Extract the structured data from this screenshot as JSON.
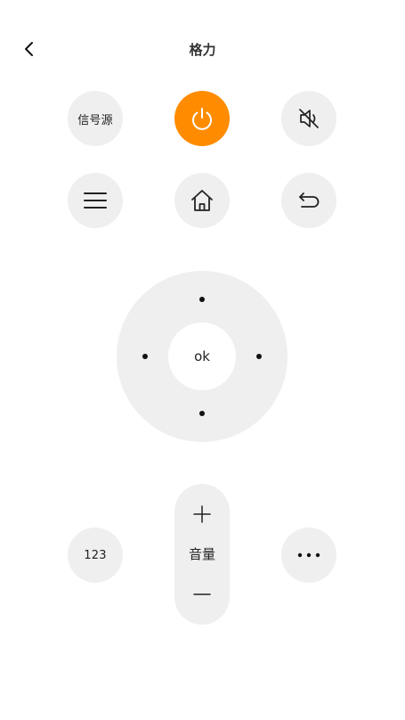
{
  "header": {
    "title": "格力",
    "back_icon": "chevron-left-icon"
  },
  "colors": {
    "power_accent": "#FF8C00",
    "button_bg": "#EFEFEF",
    "background": "#FFFFFF"
  },
  "row1": {
    "source_label": "信号源",
    "power_icon": "power-icon",
    "mute_icon": "volume-mute-icon"
  },
  "row2": {
    "menu_icon": "menu-icon",
    "home_icon": "home-icon",
    "back_icon": "return-icon"
  },
  "dpad": {
    "ok_label": "ok"
  },
  "bottom": {
    "numpad_label": "123",
    "volume_label": "音量",
    "volume_up_icon": "plus-icon",
    "volume_down_icon": "minus-icon",
    "more_icon": "more-dots-icon"
  }
}
